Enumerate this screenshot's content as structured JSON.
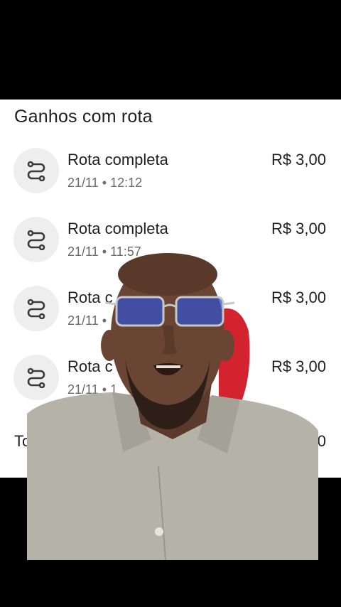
{
  "section": {
    "title": "Ganhos com rota"
  },
  "rows": [
    {
      "title": "Rota completa",
      "date": "21/11",
      "sep": "•",
      "time": "12:12",
      "amount": "R$ 3,00",
      "icon": "route-icon"
    },
    {
      "title": "Rota completa",
      "date": "21/11",
      "sep": "•",
      "time": "11:57",
      "amount": "R$ 3,00",
      "icon": "route-icon"
    },
    {
      "title": "Rota c",
      "date": "21/11",
      "sep": "•",
      "time": "",
      "amount": "R$ 3,00",
      "icon": "route-icon"
    },
    {
      "title": "Rota c",
      "date": "21/11",
      "sep": "•",
      "time": "1",
      "amount": "R$ 3,00",
      "icon": "route-icon"
    }
  ],
  "total": {
    "label": "Tot",
    "value": "0"
  },
  "colors": {
    "background": "#000000",
    "card": "#ffffff",
    "icon_bg": "#eeeeee",
    "text_primary": "#1f1f1f",
    "text_secondary": "#6b6b6b"
  }
}
